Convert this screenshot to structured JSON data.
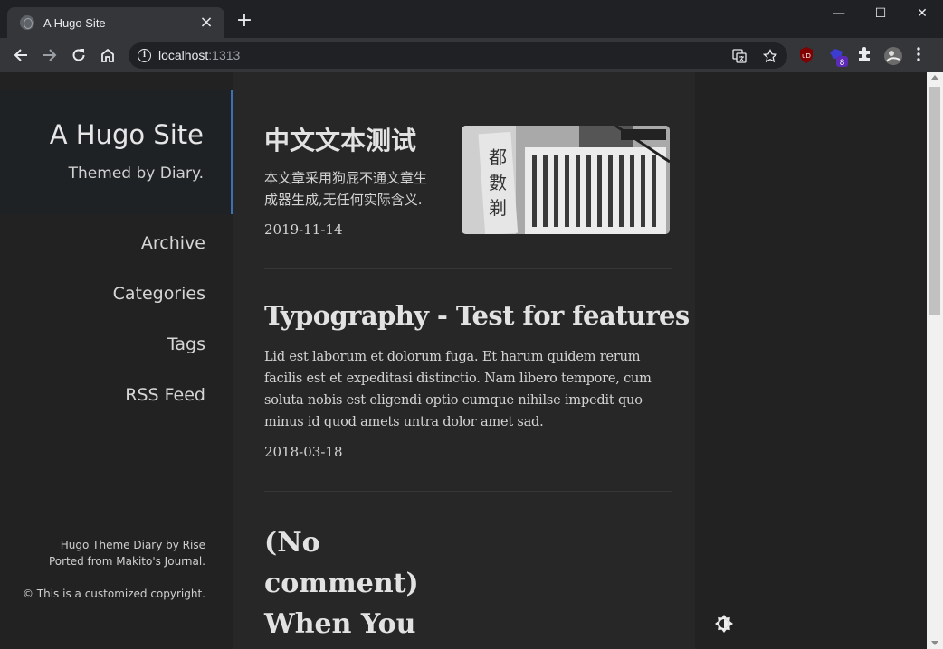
{
  "browser": {
    "tab_title": "A Hugo Site",
    "tab_close": "×",
    "new_tab": "+",
    "url_host": "localhost",
    "url_port": ":1313",
    "extension_badge": "8",
    "window_controls": {
      "minimize": "—",
      "maximize": "☐",
      "close": "✕"
    }
  },
  "sidebar": {
    "title": "A Hugo Site",
    "subtitle": "Themed by Diary.",
    "menu": [
      {
        "label": "Archive"
      },
      {
        "label": "Categories"
      },
      {
        "label": "Tags"
      },
      {
        "label": "RSS Feed"
      }
    ],
    "footer": {
      "credit_line1": "Hugo Theme Diary by Rise",
      "credit_line2": "Ported from Makito's Journal.",
      "copyright": "© This is a customized copyright."
    }
  },
  "posts": [
    {
      "title": "中文文本测试",
      "summary_line1": "本文章采用狗屁不通文章生",
      "summary_line2": "成器生成,无任何实际含义.",
      "date": "2019-11-14",
      "has_image": true
    },
    {
      "title": "Typography - Test for features",
      "summary_lines": [
        "Lid est laborum et dolorum fuga. Et harum quidem rerum",
        "facilis est et expeditasi distinctio. Nam libero tempore, cum",
        "soluta nobis est eligendi optio cumque nihilse impedit quo",
        "minus id quod amets untra dolor amet sad."
      ],
      "date": "2018-03-18"
    },
    {
      "title_lines": [
        "(No",
        "comment)",
        "When You"
      ]
    }
  ],
  "icons": {
    "theme_toggle": "sun-half-icon",
    "back": "back-arrow-icon",
    "forward": "forward-arrow-icon",
    "reload": "reload-icon",
    "home": "home-icon"
  },
  "colors": {
    "accent_border": "#3b6fb6",
    "background": "#202020",
    "main_panel": "#272727"
  }
}
